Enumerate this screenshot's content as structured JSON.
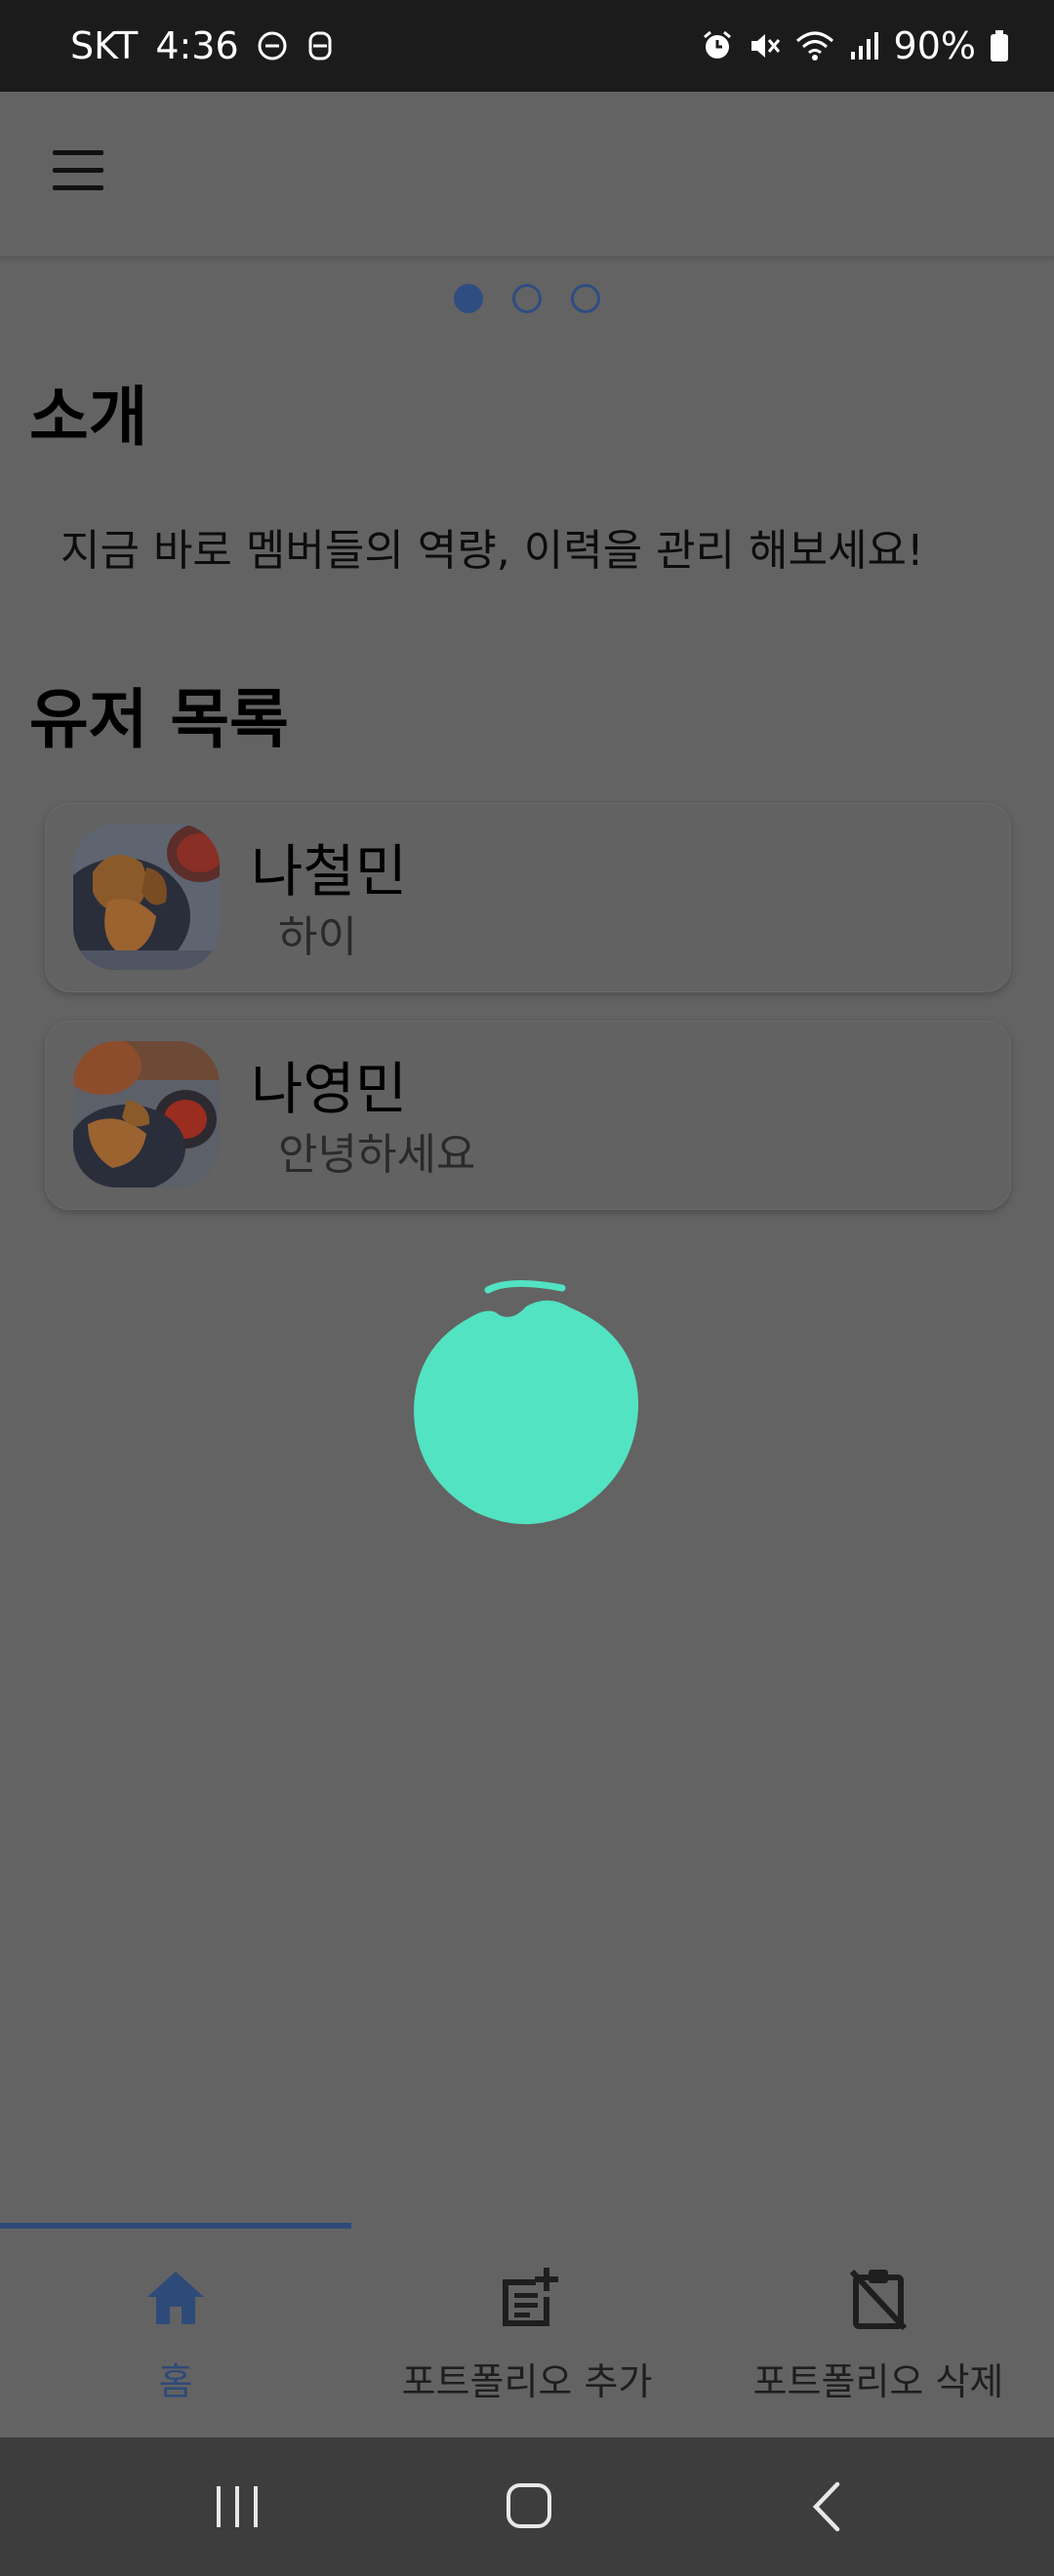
{
  "status_bar": {
    "carrier": "SKT",
    "time": "4:36",
    "battery": "90%",
    "icons": [
      "dnd-icon",
      "vpn-key-icon",
      "alarm-icon",
      "mute-icon",
      "wifi-icon",
      "signal-icon",
      "battery-icon"
    ]
  },
  "header": {
    "menu_icon": "hamburger-menu-icon"
  },
  "carousel": {
    "pages": 3,
    "active_index": 0
  },
  "intro": {
    "title": "소개",
    "text": "지금 바로 멤버들의 역량, 이력을 관리 해보세요!"
  },
  "users": {
    "title": "유저 목록",
    "items": [
      {
        "name": "나철민",
        "message": "하이"
      },
      {
        "name": "나영민",
        "message": "안녕하세요"
      }
    ]
  },
  "loading": {
    "color": "#52e3c2"
  },
  "bottom_nav": {
    "items": [
      {
        "label": "홈",
        "icon": "home-icon",
        "active": true
      },
      {
        "label": "포트폴리오 추가",
        "icon": "add-note-icon",
        "active": false
      },
      {
        "label": "포트폴리오 삭제",
        "icon": "clipboard-off-icon",
        "active": false
      }
    ],
    "accent": "#2e4a78"
  },
  "system_nav": {
    "icons": [
      "recent-apps-icon",
      "home-button-icon",
      "back-icon"
    ]
  }
}
